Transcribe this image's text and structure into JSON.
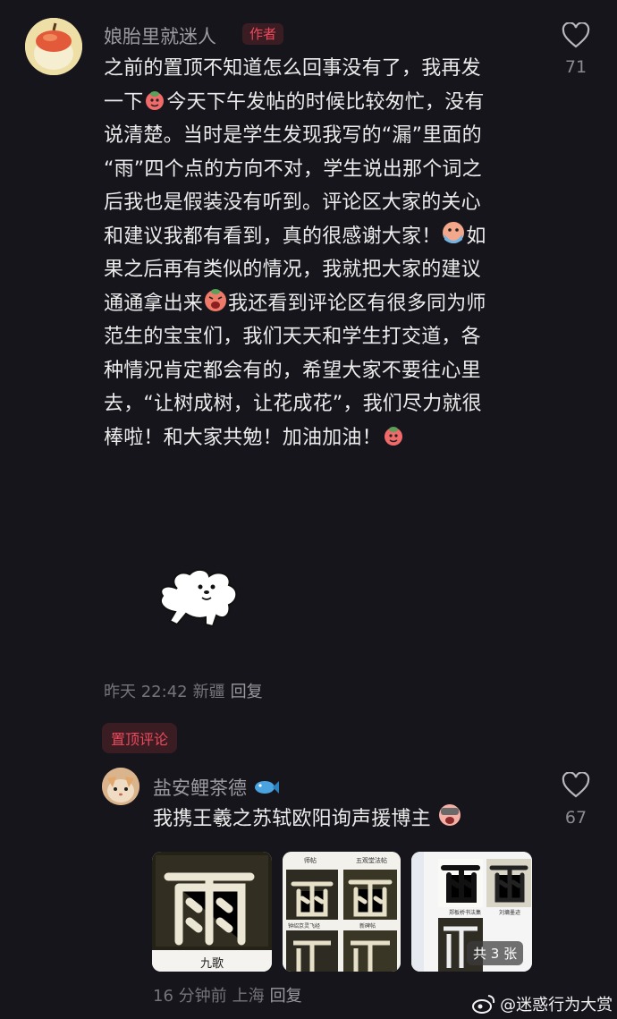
{
  "comment1": {
    "username": "娘胎里就迷人",
    "badge": "作者",
    "lines": [
      "之前的置顶不知道怎么回事没有了，我再发",
      "一下[e1]今天下午发帖的时候比较匆忙，没有",
      "说清楚。当时是学生发现我写的“漏”里面的",
      "“雨”四个点的方向不对，学生说出那个词之",
      "后我也是假装没有听到。评论区大家的关心",
      "和建议我都有看到，真的很感谢大家！[e2]如",
      "果之后再有类似的情况，我就把大家的建议",
      "通通拿出来[e3]我还看到评论区有很多同为师",
      "范生的宝宝们，我们天天和学生打交道，各",
      "种情况肯定都会有的，希望大家不要往心里",
      "去，“让树成树，让花成花”，我们尽力就很",
      "棒啦！和大家共勉！加油加油！[e4]"
    ],
    "time": "昨天 22:42",
    "location": "新疆",
    "reply": "回复",
    "likes": "71"
  },
  "pinned_label": "置顶评论",
  "comment2": {
    "username": "盐安鲤茶德",
    "text": "我携王羲之苏轼欧阳询声援博主",
    "time": "16 分钟前",
    "location": "上海",
    "reply": "回复",
    "likes": "67",
    "images": [
      {
        "caption": "九歌"
      },
      {
        "labels": [
          "师帖",
          "五观堂法帖",
          "钟绍京灵飞经",
          "新碑帖"
        ]
      },
      {
        "labels": [
          "郑板桥书法集",
          "刘墉墨迹"
        ],
        "count": "共 3 张"
      }
    ]
  },
  "watermark": "@迷惑行为大赏",
  "colors": {
    "background": "#16151b",
    "accent": "#f0485d",
    "muted": "#75747a"
  }
}
